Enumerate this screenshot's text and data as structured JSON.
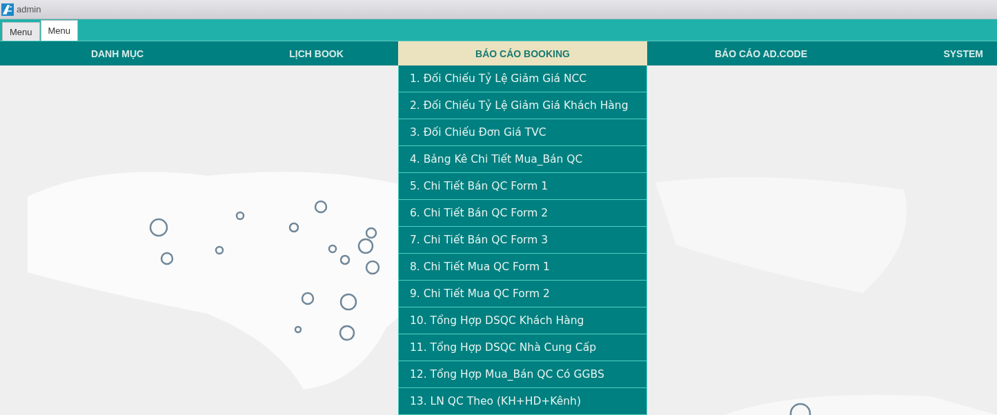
{
  "window": {
    "title": "admin"
  },
  "tabs": [
    {
      "label": "Menu",
      "selected": false
    },
    {
      "label": "Menu",
      "selected": true
    }
  ],
  "nav": [
    {
      "label": "DANH MỤC",
      "selected": false
    },
    {
      "label": "LỊCH BOOK",
      "selected": false
    },
    {
      "label": "BÁO CÁO BOOKING",
      "selected": true
    },
    {
      "label": "BÁO CÁO AD.CODE",
      "selected": false
    },
    {
      "label": "SYSTEM",
      "selected": false
    }
  ],
  "dropdown": {
    "items": [
      "1. Đối Chiếu Tỷ Lệ Giảm Giá NCC",
      "2. Đối Chiếu Tỷ Lệ Giảm Giá Khách Hàng",
      "3. Đối Chiếu Đơn Giá TVC",
      "4. Bảng Kê Chi Tiết Mua_Bán QC",
      "5. Chi Tiết Bán QC Form 1",
      "6. Chi Tiết Bán QC Form 2",
      "7. Chi Tiết Bán QC Form 3",
      "8. Chi Tiết Mua QC Form 1",
      "9. Chi Tiết Mua QC Form 2",
      "10. Tổng Hợp DSQC Khách Hàng",
      "11. Tổng Hợp DSQC Nhà Cung Cấp",
      "12. Tổng Hợp Mua_Bán QC Có GGBS",
      "13. LN QC Theo (KH+HD+Kênh)"
    ]
  }
}
